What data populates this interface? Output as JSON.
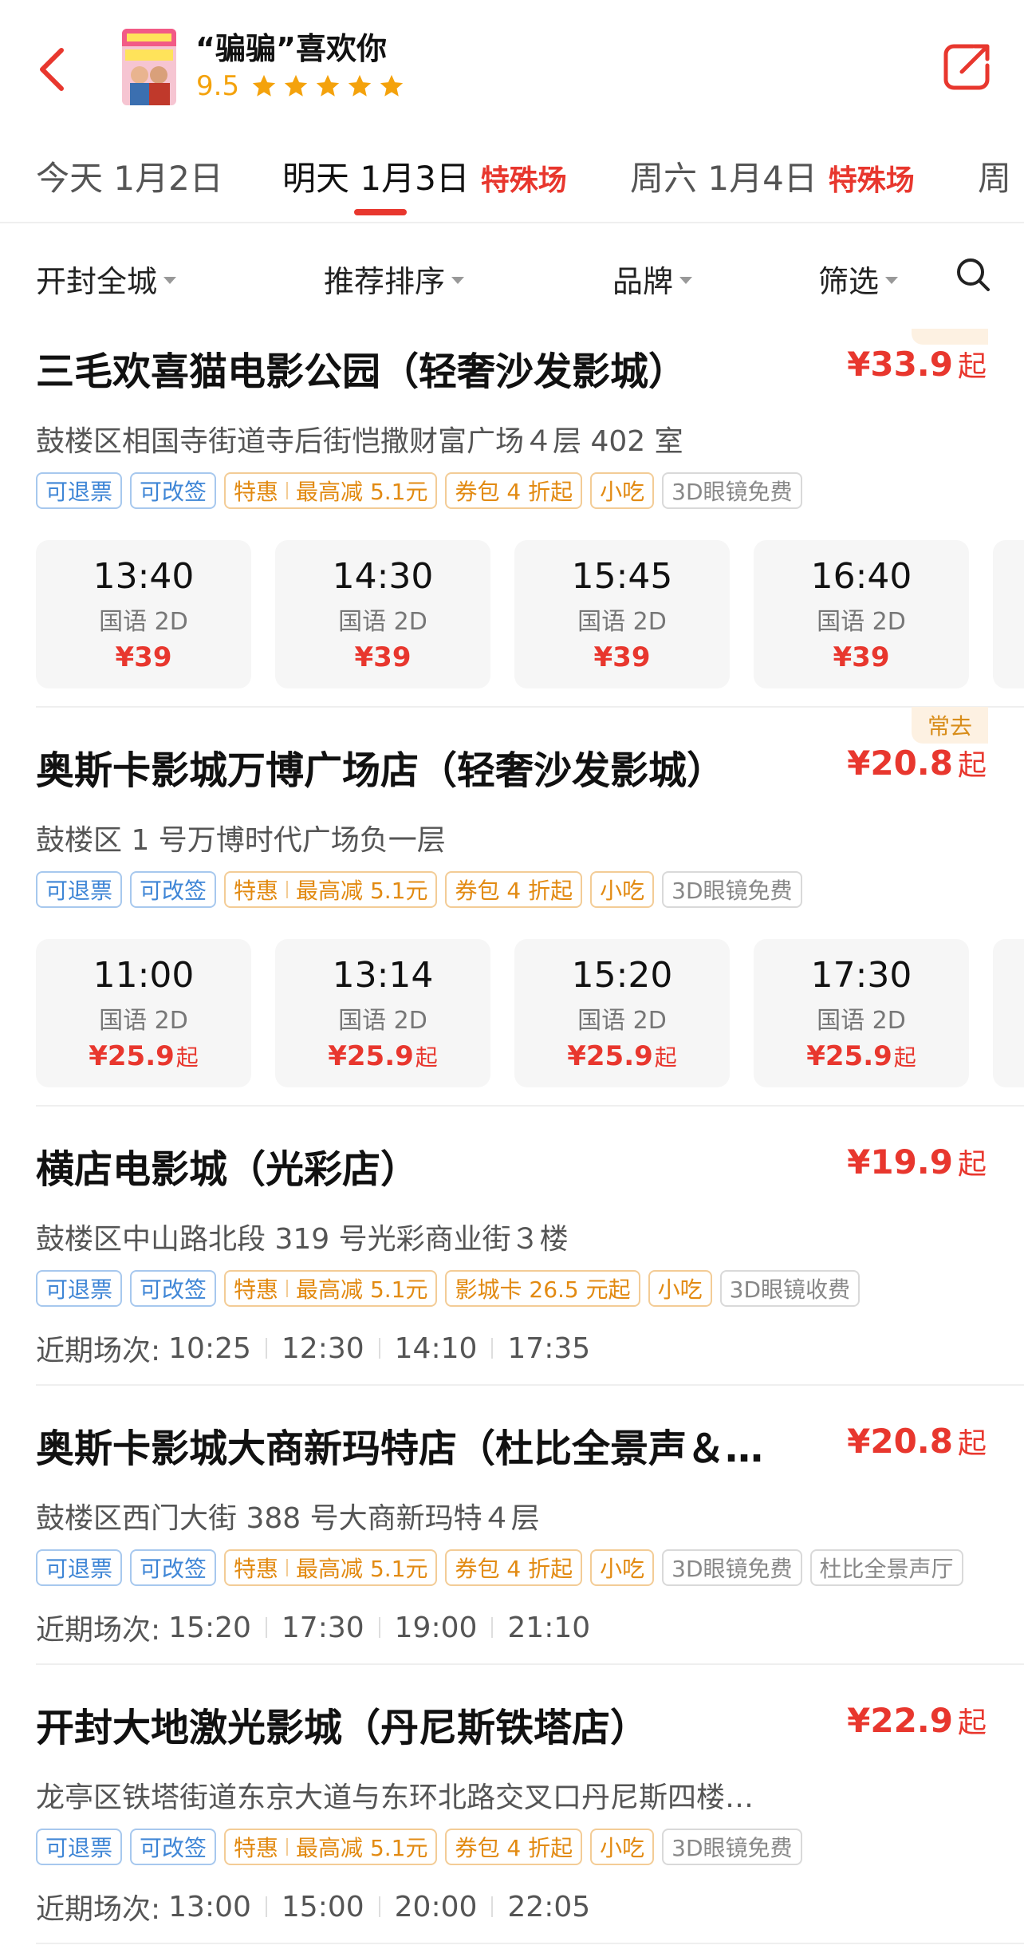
{
  "header": {
    "movie_title": "“骗骗”喜欢你",
    "rating": "9.5",
    "star_count": 5,
    "accent_color": "#e8372e",
    "star_color": "#f4a20c"
  },
  "date_tabs": [
    {
      "label": "今天 1月2日",
      "special": "",
      "active": false
    },
    {
      "label": "明天 1月3日",
      "special": "特殊场",
      "active": true
    },
    {
      "label": "周六 1月4日",
      "special": "特殊场",
      "active": false
    },
    {
      "label": "周",
      "special": "",
      "active": false
    }
  ],
  "filters": {
    "area": "开封全城",
    "sort": "推荐排序",
    "brand": "品牌",
    "screen": "筛选"
  },
  "cinemas": [
    {
      "name": "三毛欢喜猫电影公园（轻奢沙发影城）",
      "price": "¥33.9",
      "price_suffix": "起",
      "address": "鼓楼区相国寺街道寺后街恺撒财富广场４层 402 室",
      "tags": {
        "refund": "可退票",
        "change": "可改签",
        "deal_label": "特惠",
        "deal_value": "最高减 5.1元",
        "pack": "券包 4 折起",
        "snack": "小吃",
        "glasses": "3D眼镜免费"
      },
      "showtimes": [
        {
          "time": "13:40",
          "lang": "国语 2D",
          "price": "¥39",
          "suffix": ""
        },
        {
          "time": "14:30",
          "lang": "国语 2D",
          "price": "¥39",
          "suffix": ""
        },
        {
          "time": "15:45",
          "lang": "国语 2D",
          "price": "¥39",
          "suffix": ""
        },
        {
          "time": "16:40",
          "lang": "国语 2D",
          "price": "¥39",
          "suffix": ""
        }
      ]
    },
    {
      "name": "奥斯卡影城万博广场店（轻奢沙发影城）",
      "badge": "常去",
      "price": "¥20.8",
      "price_suffix": "起",
      "address": "鼓楼区 1 号万博时代广场负一层",
      "tags": {
        "refund": "可退票",
        "change": "可改签",
        "deal_label": "特惠",
        "deal_value": "最高减 5.1元",
        "pack": "券包 4 折起",
        "snack": "小吃",
        "glasses": "3D眼镜免费"
      },
      "showtimes": [
        {
          "time": "11:00",
          "lang": "国语 2D",
          "price": "¥25.9",
          "suffix": "起"
        },
        {
          "time": "13:14",
          "lang": "国语 2D",
          "price": "¥25.9",
          "suffix": "起"
        },
        {
          "time": "15:20",
          "lang": "国语 2D",
          "price": "¥25.9",
          "suffix": "起"
        },
        {
          "time": "17:30",
          "lang": "国语 2D",
          "price": "¥25.9",
          "suffix": "起"
        }
      ]
    },
    {
      "name": "横店电影城（光彩店）",
      "price": "¥19.9",
      "price_suffix": "起",
      "address": "鼓楼区中山路北段 319 号光彩商业街３楼",
      "tags": {
        "refund": "可退票",
        "change": "可改签",
        "deal_label": "特惠",
        "deal_value": "最高减 5.1元",
        "card": "影城卡 26.5 元起",
        "snack": "小吃",
        "glasses": "3D眼镜收费"
      },
      "recent_label": "近期场次:",
      "recent": [
        "10:25",
        "12:30",
        "14:10",
        "17:35"
      ]
    },
    {
      "name": "奥斯卡影城大商新玛特店（杜比全景声＆…",
      "price": "¥20.8",
      "price_suffix": "起",
      "address": "鼓楼区西门大街 388 号大商新玛特４层",
      "tags": {
        "refund": "可退票",
        "change": "可改签",
        "deal_label": "特惠",
        "deal_value": "最高减 5.1元",
        "pack": "券包 4 折起",
        "snack": "小吃",
        "glasses": "3D眼镜免费",
        "dolby": "杜比全景声厅"
      },
      "recent_label": "近期场次:",
      "recent": [
        "15:20",
        "17:30",
        "19:00",
        "21:10"
      ]
    },
    {
      "name": "开封大地激光影城（丹尼斯铁塔店）",
      "price": "¥22.9",
      "price_suffix": "起",
      "address": "龙亭区铁塔街道东京大道与东环北路交叉口丹尼斯四楼…",
      "tags": {
        "refund": "可退票",
        "change": "可改签",
        "deal_label": "特惠",
        "deal_value": "最高减 5.1元",
        "pack": "券包 4 折起",
        "snack": "小吃",
        "glasses": "3D眼镜免费"
      },
      "recent_label": "近期场次:",
      "recent": [
        "13:00",
        "15:00",
        "20:00",
        "22:05"
      ]
    }
  ]
}
